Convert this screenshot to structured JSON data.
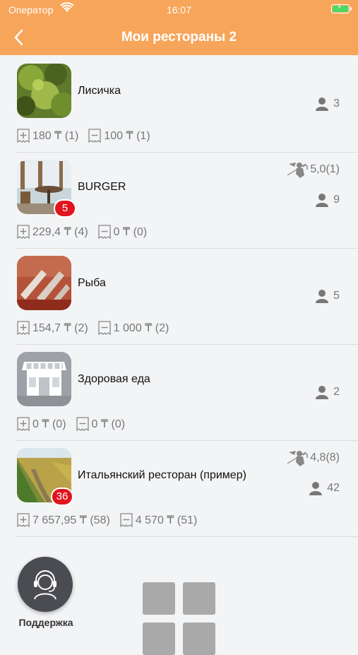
{
  "status_bar": {
    "carrier": "Оператор",
    "time": "16:07"
  },
  "nav": {
    "title": "Мои рестораны 2"
  },
  "restaurants": [
    {
      "name": "Лисичка",
      "rating": "",
      "guests": "3",
      "badge": "",
      "income": "180 ₸ (1)",
      "expense": "100 ₸ (1)"
    },
    {
      "name": "BURGER",
      "rating": "5,0(1)",
      "guests": "9",
      "badge": "5",
      "income": "229,4 ₸ (4)",
      "expense": "0 ₸ (0)"
    },
    {
      "name": "Рыба",
      "rating": "",
      "guests": "5",
      "badge": "",
      "income": "154,7 ₸ (2)",
      "expense": "1 000 ₸ (2)"
    },
    {
      "name": "Здоровая еда",
      "rating": "",
      "guests": "2",
      "badge": "",
      "income": "0 ₸ (0)",
      "expense": "0 ₸ (0)"
    },
    {
      "name": "Итальянский ресторан (пример)",
      "rating": "4,8(8)",
      "guests": "42",
      "badge": "36",
      "income": "7 657,95 ₸ (58)",
      "expense": "4 570 ₸ (51)"
    }
  ],
  "support": {
    "label": "Поддержка"
  },
  "colors": {
    "header": "#f7a55a",
    "badge": "#e0141e",
    "muted": "#777777"
  }
}
